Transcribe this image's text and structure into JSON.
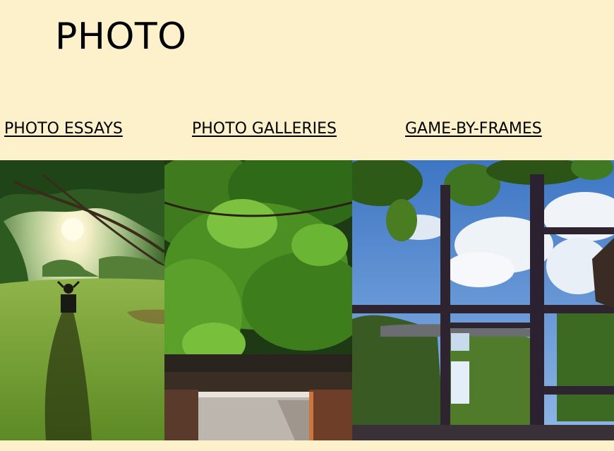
{
  "page": {
    "title": "PHOTO"
  },
  "nav": {
    "items": [
      {
        "label": "PHOTO ESSAYS"
      },
      {
        "label": "PHOTO GALLERIES"
      },
      {
        "label": "GAME-BY-FRAMES"
      }
    ]
  },
  "photos": [
    {
      "subject": "Person sitting on lawn chair in a park at sunset, long shadow under trees"
    },
    {
      "subject": "Lush green tree foliage over a brick building entrance"
    },
    {
      "subject": "Dark window frames reflecting blue sky, clouds and trees"
    }
  ],
  "colors": {
    "background": "#fdf1cc",
    "link": "#000000"
  }
}
